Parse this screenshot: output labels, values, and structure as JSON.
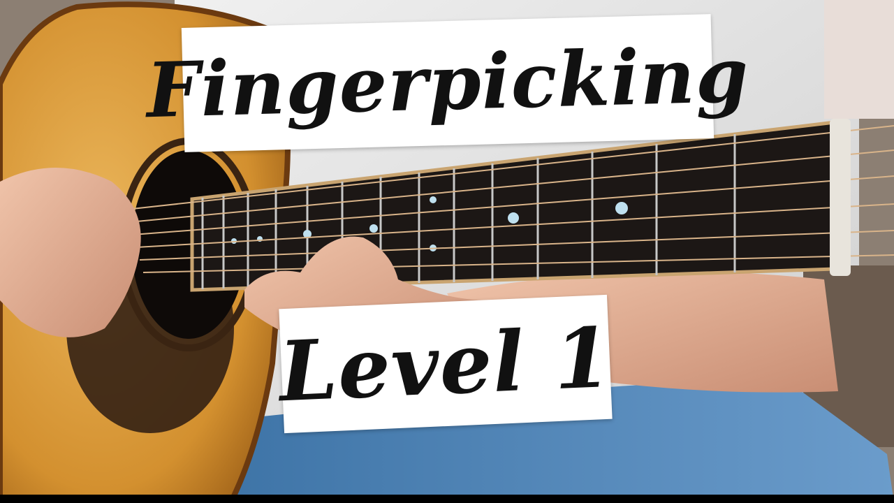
{
  "title": {
    "line1": "Fingerpicking",
    "line2": "Level 1"
  },
  "colors": {
    "card_bg": "#ffffff",
    "text": "#111111",
    "guitar_top": "#d99a3a",
    "fretboard": "#1c1715",
    "shirt": "#e6e6e6",
    "jeans": "#4e86b8",
    "skin": "#e0ad92"
  }
}
